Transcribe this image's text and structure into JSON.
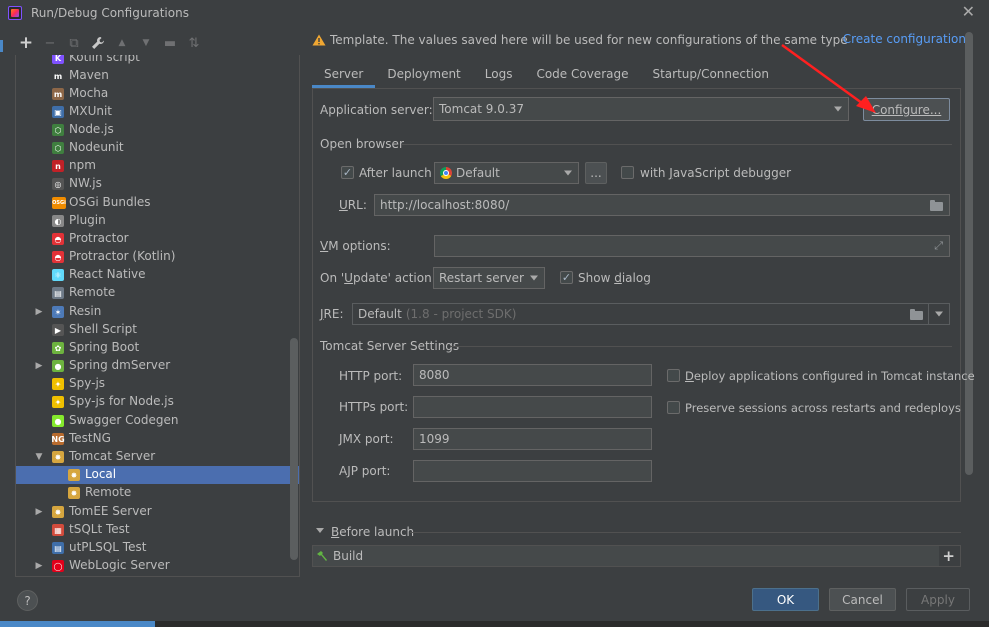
{
  "window": {
    "title": "Run/Debug Configurations",
    "close_glyph": "✕"
  },
  "toolbar": {
    "icons": [
      "add-icon",
      "remove-icon",
      "copy-icon",
      "wrench-icon",
      "move-up-icon",
      "move-down-icon",
      "folder-icon",
      "sort-icon"
    ],
    "glyphs": {
      "add": "+",
      "remove": "−",
      "copy": "⧉",
      "wrench": "🔧",
      "up": "▲",
      "down": "▼",
      "folder": "▬",
      "sort": "⇅"
    }
  },
  "tree": {
    "items": [
      {
        "label": "Kotlin script",
        "icon": "kotlin-icon",
        "color": "#7f52ff",
        "glyph": "K"
      },
      {
        "label": "Maven",
        "icon": "maven-icon",
        "color": "#3c3f41",
        "glyph": "m"
      },
      {
        "label": "Mocha",
        "icon": "mocha-icon",
        "color": "#8d6748",
        "glyph": "m"
      },
      {
        "label": "MXUnit",
        "icon": "mxunit-icon",
        "color": "#3f6ea8",
        "glyph": "▣"
      },
      {
        "label": "Node.js",
        "icon": "nodejs-icon",
        "color": "#3f7f3f",
        "glyph": "⬡"
      },
      {
        "label": "Nodeunit",
        "icon": "nodeunit-icon",
        "color": "#3f7f3f",
        "glyph": "⬡"
      },
      {
        "label": "npm",
        "icon": "npm-icon",
        "color": "#c12127",
        "glyph": "n"
      },
      {
        "label": "NW.js",
        "icon": "nwjs-icon",
        "color": "#555555",
        "glyph": "◎"
      },
      {
        "label": "OSGi Bundles",
        "icon": "osgi-icon",
        "color": "#f08c00",
        "glyph": "OSGi"
      },
      {
        "label": "Plugin",
        "icon": "plugin-icon",
        "color": "#888888",
        "glyph": "◐"
      },
      {
        "label": "Protractor",
        "icon": "protractor-icon",
        "color": "#e23237",
        "glyph": "◓"
      },
      {
        "label": "Protractor (Kotlin)",
        "icon": "protractor-kotlin-icon",
        "color": "#e23237",
        "glyph": "◓"
      },
      {
        "label": "React Native",
        "icon": "react-native-icon",
        "color": "#61dafb",
        "glyph": "⚛"
      },
      {
        "label": "Remote",
        "icon": "remote-icon",
        "color": "#6e7a87",
        "glyph": "▤"
      },
      {
        "label": "Resin",
        "icon": "resin-icon",
        "color": "#4d7ab8",
        "glyph": "✶"
      },
      {
        "label": "Shell Script",
        "icon": "shell-script-icon",
        "color": "#555555",
        "glyph": "▶"
      },
      {
        "label": "Spring Boot",
        "icon": "spring-boot-icon",
        "color": "#6db33f",
        "glyph": "✿"
      },
      {
        "label": "Spring dmServer",
        "icon": "spring-dmserver-icon",
        "color": "#6db33f",
        "glyph": "●"
      },
      {
        "label": "Spy-js",
        "icon": "spyjs-icon",
        "color": "#f0c000",
        "glyph": "✦"
      },
      {
        "label": "Spy-js for Node.js",
        "icon": "spyjs-node-icon",
        "color": "#f0c000",
        "glyph": "✦"
      },
      {
        "label": "Swagger Codegen",
        "icon": "swagger-icon",
        "color": "#85ea2d",
        "glyph": "●"
      },
      {
        "label": "TestNG",
        "icon": "testng-icon",
        "color": "#b86b2e",
        "glyph": "NG"
      },
      {
        "label": "Tomcat Server",
        "icon": "tomcat-icon",
        "color": "#d6a63f",
        "glyph": "✸"
      },
      {
        "label": "Local",
        "icon": "tomcat-local-icon",
        "color": "#d6a63f",
        "glyph": "✸"
      },
      {
        "label": "Remote",
        "icon": "tomcat-remote-icon",
        "color": "#d6a63f",
        "glyph": "✸"
      },
      {
        "label": "TomEE Server",
        "icon": "tomee-icon",
        "color": "#d6a63f",
        "glyph": "✸"
      },
      {
        "label": "tSQLt Test",
        "icon": "tsqlt-icon",
        "color": "#d24b3c",
        "glyph": "▦"
      },
      {
        "label": "utPLSQL Test",
        "icon": "utplsql-icon",
        "color": "#3f6ea8",
        "glyph": "▤"
      },
      {
        "label": "WebLogic Server",
        "icon": "weblogic-icon",
        "color": "#e2001a",
        "glyph": "◯"
      }
    ]
  },
  "template_bar": {
    "text": "Template. The values saved here will be used for new configurations of the same type",
    "link": "Create configuration"
  },
  "tabs": [
    "Server",
    "Deployment",
    "Logs",
    "Code Coverage",
    "Startup/Connection"
  ],
  "server": {
    "app_server_label": "Application server:",
    "app_server_value": "Tomcat 9.0.37",
    "configure_button": "Configure...",
    "open_browser_title": "Open browser",
    "after_launch_label": "After launch",
    "browser_value": "Default",
    "browse_button": "...",
    "js_debugger_label": "with JavaScript debugger",
    "url_label": "URL:",
    "url_value": "http://localhost:8080/",
    "vm_options_label": "VM options:",
    "vm_options_value": "",
    "on_update_label": "On 'Update' action:",
    "on_update_value": "Restart server",
    "show_dialog_label": "Show dialog",
    "jre_label": "JRE:",
    "jre_value": "Default",
    "jre_hint": "(1.8 - project SDK)",
    "tomcat_settings_title": "Tomcat Server Settings",
    "http_port_label": "HTTP port:",
    "http_port_value": "8080",
    "https_port_label": "HTTPs port:",
    "https_port_value": "",
    "jmx_port_label": "JMX port:",
    "jmx_port_value": "1099",
    "ajp_port_label": "AJP port:",
    "ajp_port_value": "",
    "deploy_label": "Deploy applications configured in Tomcat instance",
    "preserve_label": "Preserve sessions across restarts and redeploys"
  },
  "before_launch": {
    "title": "Before launch",
    "item": "Build",
    "add": "+"
  },
  "footer": {
    "ok": "OK",
    "cancel": "Cancel",
    "apply": "Apply",
    "help": "?"
  },
  "colors": {
    "background": "#3c3f41",
    "selection": "#4b6eaf",
    "link": "#589df6",
    "primary_button": "#365880",
    "annotation": "#ff2020"
  }
}
